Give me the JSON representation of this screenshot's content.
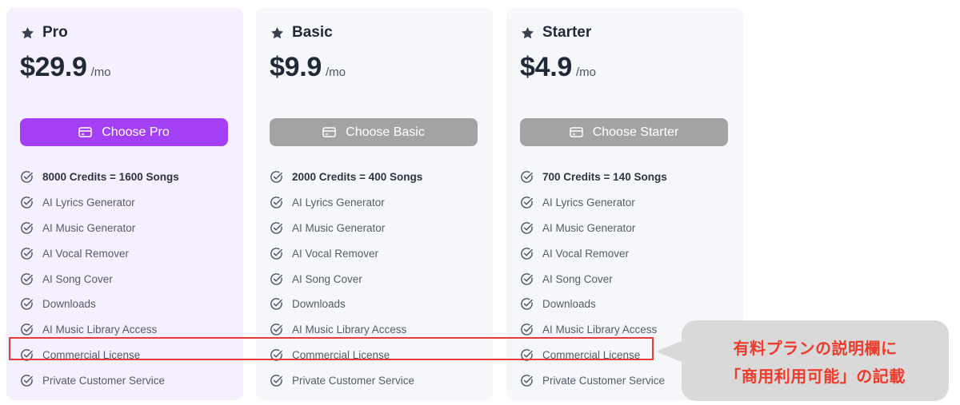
{
  "plans": [
    {
      "name": "Pro",
      "price": "$29.9",
      "period": "/mo",
      "button_label": "Choose Pro",
      "features": [
        "8000 Credits = 1600 Songs",
        "AI Lyrics Generator",
        "AI Music Generator",
        "AI Vocal Remover",
        "AI Song Cover",
        "Downloads",
        "AI Music Library Access",
        "Commercial License",
        "Private Customer Service"
      ]
    },
    {
      "name": "Basic",
      "price": "$9.9",
      "period": "/mo",
      "button_label": "Choose Basic",
      "features": [
        "2000 Credits = 400 Songs",
        "AI Lyrics Generator",
        "AI Music Generator",
        "AI Vocal Remover",
        "AI Song Cover",
        "Downloads",
        "AI Music Library Access",
        "Commercial License",
        "Private Customer Service"
      ]
    },
    {
      "name": "Starter",
      "price": "$4.9",
      "period": "/mo",
      "button_label": "Choose Starter",
      "features": [
        "700 Credits = 140 Songs",
        "AI Lyrics Generator",
        "AI Music Generator",
        "AI Vocal Remover",
        "AI Song Cover",
        "Downloads",
        "AI Music Library Access",
        "Commercial License",
        "Private Customer Service"
      ]
    }
  ],
  "annotation": {
    "line1": "有料プランの説明欄に",
    "line2": "「商用利用可能」の記載"
  },
  "icons": {
    "plan": "star-icon",
    "button": "credit-card-icon",
    "feature": "check-circle-icon"
  },
  "colors": {
    "accent": "#a340f5",
    "disabled_button": "#a3a3a3",
    "highlight": "#e53b3b",
    "annotation_text": "#ee3b2b"
  }
}
